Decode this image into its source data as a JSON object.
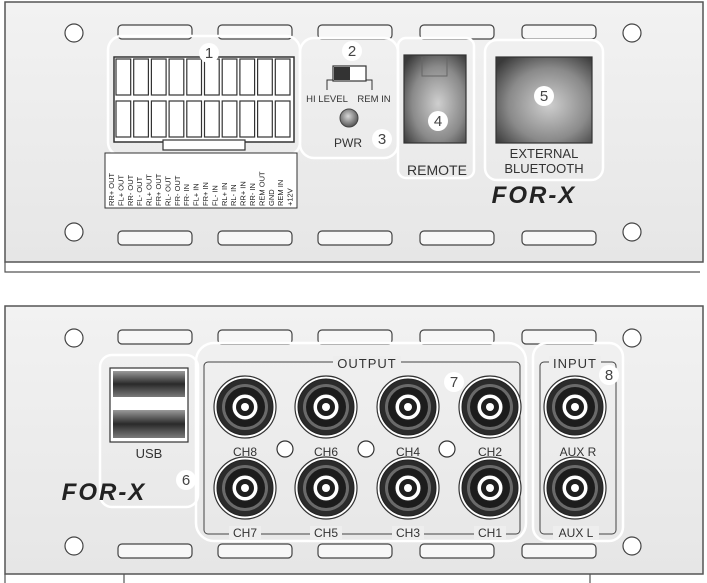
{
  "brand": "FOR-X",
  "top_panel": {
    "callouts": [
      "1",
      "2",
      "3",
      "4",
      "5"
    ],
    "pin_labels_top": [
      "RR+ OUT",
      "FL+ OUT",
      "RR- OUT",
      "FL- OUT",
      "RL+ OUT",
      "FR+ OUT",
      "RL- OUT",
      "FR- OUT",
      "FR- IN",
      "FL+ IN",
      "FR+ IN",
      "FL- IN",
      "RL- IN",
      "RR- IN",
      "RL+ IN",
      "GND",
      "REM OUT",
      "+12V",
      "REM IN"
    ],
    "pin_labels": [
      {
        "top": "RR+",
        "bottom": "OUT"
      },
      {
        "top": "FL+",
        "bottom": "OUT"
      },
      {
        "top": "RR-",
        "bottom": "OUT"
      },
      {
        "top": "FL-",
        "bottom": "OUT"
      },
      {
        "top": "RL+",
        "bottom": "OUT"
      },
      {
        "top": "FR+",
        "bottom": "OUT"
      },
      {
        "top": "RL-",
        "bottom": "OUT"
      },
      {
        "top": "FR-",
        "bottom": "OUT"
      },
      {
        "top": "FR-",
        "bottom": "IN"
      },
      {
        "top": "FL+",
        "bottom": "IN"
      },
      {
        "top": "FR+",
        "bottom": "IN"
      },
      {
        "top": "FL-",
        "bottom": "IN"
      },
      {
        "top": "RL+",
        "bottom": "IN"
      },
      {
        "top": "RL-",
        "bottom": "IN"
      },
      {
        "top": "RR+",
        "bottom": "IN"
      },
      {
        "top": "RR-",
        "bottom": "IN"
      },
      {
        "top": "REM",
        "bottom": "OUT"
      },
      {
        "top": "GND",
        "bottom": ""
      },
      {
        "top": "REM",
        "bottom": "IN"
      },
      {
        "top": "+12V",
        "bottom": ""
      }
    ],
    "switch_left_label": "HI LEVEL",
    "switch_right_label": "REM IN",
    "pwr_label": "PWR",
    "remote_label": "REMOTE",
    "bluetooth_line1": "EXTERNAL",
    "bluetooth_line2": "BLUETOOTH"
  },
  "bottom_panel": {
    "callouts": [
      "6",
      "7",
      "8"
    ],
    "usb_label": "USB",
    "output_label": "OUTPUT",
    "input_label": "INPUT",
    "output_top_channels": [
      "CH8",
      "CH6",
      "CH4",
      "CH2"
    ],
    "output_bottom_channels": [
      "CH7",
      "CH5",
      "CH3",
      "CH1"
    ],
    "input_top": "AUX R",
    "input_bottom": "AUX L"
  }
}
